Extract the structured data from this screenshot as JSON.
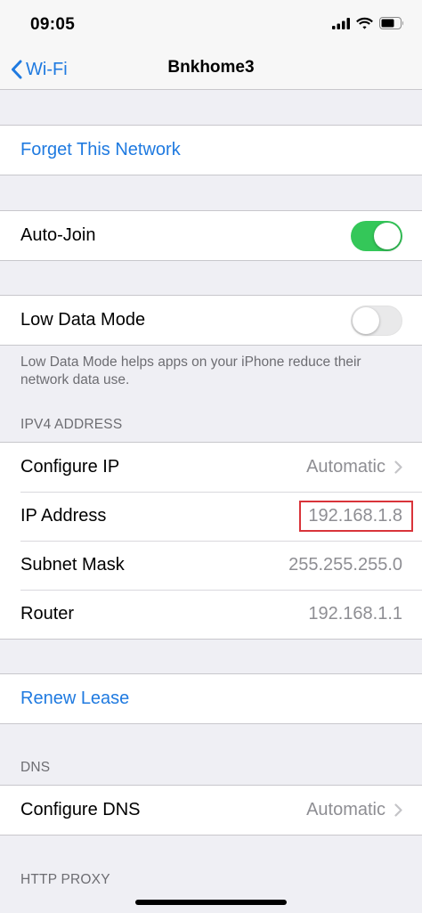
{
  "status_bar": {
    "time": "09:05"
  },
  "nav": {
    "back_label": "Wi-Fi",
    "title": "Bnkhome3"
  },
  "forget_network": {
    "label": "Forget This Network"
  },
  "auto_join": {
    "label": "Auto-Join",
    "enabled": true
  },
  "low_data_mode": {
    "label": "Low Data Mode",
    "enabled": false,
    "footer": "Low Data Mode helps apps on your iPhone reduce their network data use."
  },
  "ipv4": {
    "header": "IPV4 ADDRESS",
    "rows": [
      {
        "label": "Configure IP",
        "value": "Automatic"
      },
      {
        "label": "IP Address",
        "value": "192.168.1.8"
      },
      {
        "label": "Subnet Mask",
        "value": "255.255.255.0"
      },
      {
        "label": "Router",
        "value": "192.168.1.1"
      }
    ]
  },
  "renew_lease": {
    "label": "Renew Lease"
  },
  "dns": {
    "header": "DNS",
    "configure_label": "Configure DNS",
    "configure_value": "Automatic"
  },
  "http_proxy": {
    "header": "HTTP PROXY"
  },
  "colors": {
    "accent": "#1f7ae0",
    "toggle_on": "#34c759",
    "highlight": "#d9343a"
  }
}
